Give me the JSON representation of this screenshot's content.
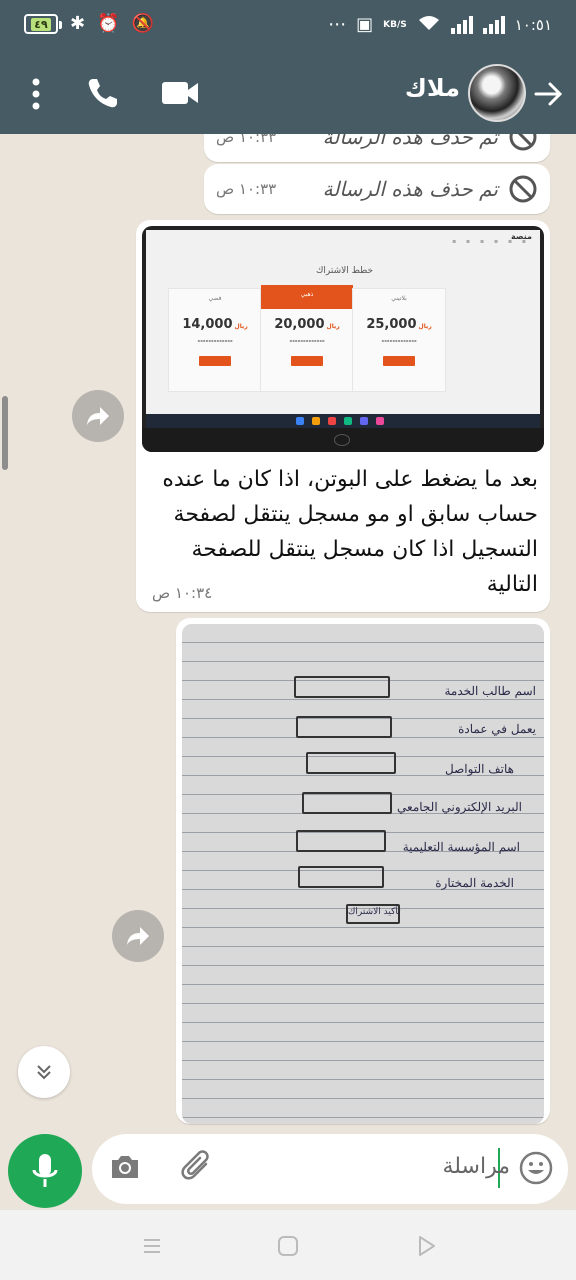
{
  "status_bar": {
    "battery": "٤٩",
    "speed_unit": "KB/S",
    "time": "١٠:٥١"
  },
  "header": {
    "contact_name": "ملاك"
  },
  "messages": {
    "deleted_1": {
      "text": "تم حذف هذه الرسالة",
      "time": "١٠:٣٣ ص"
    },
    "deleted_2": {
      "text": "تم حذف هذه الرسالة",
      "time": "١٠:٣٣ ص"
    },
    "image_1": {
      "screenshot": {
        "title": "خطط الاشتراك",
        "plans": [
          {
            "name": "فضي",
            "price": "14,000",
            "currency": "ريال"
          },
          {
            "name": "ذهبي",
            "price": "20,000",
            "currency": "ريال"
          },
          {
            "name": "بلاتيني",
            "price": "25,000",
            "currency": "ريال"
          }
        ]
      },
      "caption": "بعد ما يضغط على البوتن، اذا كان ما عنده حساب سابق او مو مسجل ينتقل لصفحة التسجيل اذا كان مسجل ينتقل للصفحة التالية",
      "time": "١٠:٣٤ ص"
    },
    "image_2": {
      "form_labels": [
        "اسم طالب الخدمة",
        "يعمل في عمادة",
        "هاتف التواصل",
        "البريد الإلكتروني الجامعي",
        "اسم المؤسسة التعليمية",
        "الخدمة المختارة"
      ],
      "submit_label": "تأكيد الاشتراك"
    }
  },
  "input": {
    "placeholder": "مراسلة"
  },
  "colors": {
    "header": "#465b63",
    "accent_green": "#1fa855",
    "chat_bg": "#ebe4da",
    "plan_orange": "#e2541b"
  }
}
